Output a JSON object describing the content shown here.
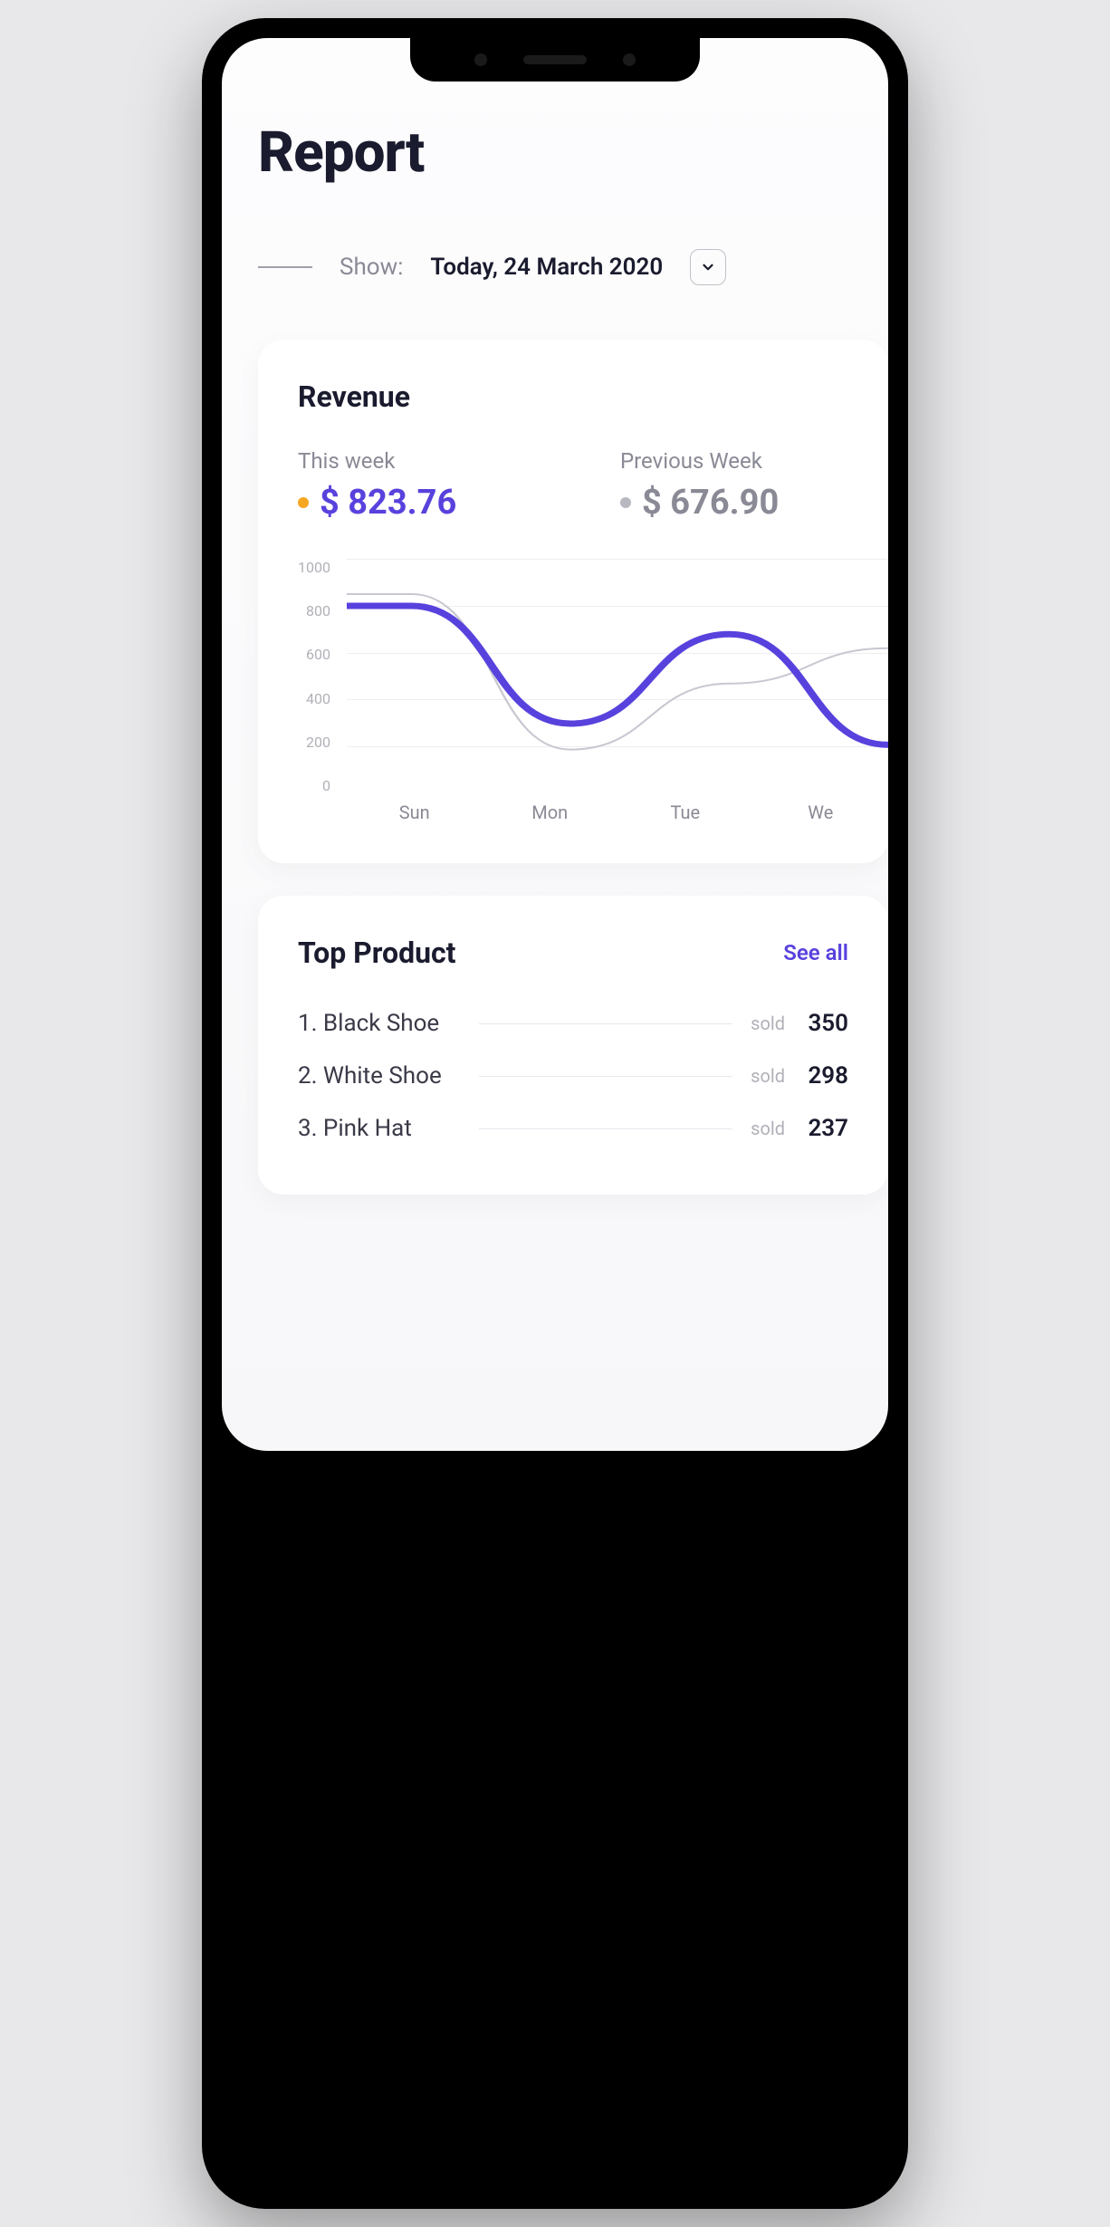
{
  "page": {
    "title": "Report"
  },
  "filter": {
    "label": "Show:",
    "value": "Today, 24 March 2020"
  },
  "revenue": {
    "title": "Revenue",
    "this_week": {
      "label": "This week",
      "value": "$ 823.76",
      "color": "#5842dd"
    },
    "prev_week": {
      "label": "Previous Week",
      "value": "$ 676.90",
      "color": "#8a8a96"
    }
  },
  "top_product": {
    "title": "Top Product",
    "see_all": "See all",
    "sold_label": "sold",
    "items": [
      {
        "rank": "1.",
        "name": "Black Shoe",
        "sold": "350"
      },
      {
        "rank": "2.",
        "name": "White Shoe",
        "sold": "298"
      },
      {
        "rank": "3.",
        "name": "Pink Hat",
        "sold": "237"
      }
    ]
  },
  "chart_data": {
    "type": "line",
    "title": "Revenue",
    "ylabel": "",
    "xlabel": "",
    "ylim": [
      0,
      1000
    ],
    "y_ticks": [
      "1000",
      "800",
      "600",
      "400",
      "200",
      "0"
    ],
    "categories": [
      "Sun",
      "Mon",
      "Tue",
      "We"
    ],
    "series": [
      {
        "name": "This week",
        "color": "#5842dd",
        "values": [
          800,
          300,
          680,
          210
        ]
      },
      {
        "name": "Previous Week",
        "color": "#c8c8d2",
        "values": [
          850,
          190,
          470,
          620
        ]
      }
    ]
  }
}
